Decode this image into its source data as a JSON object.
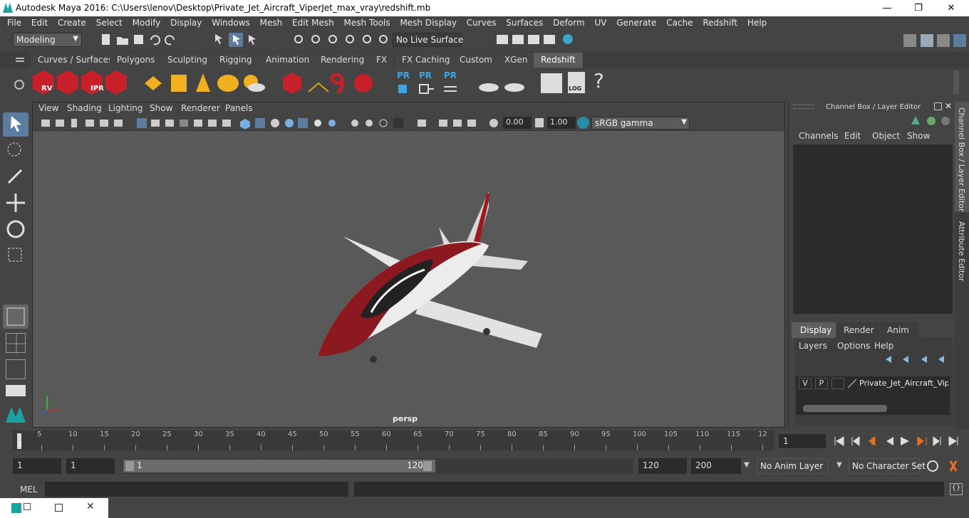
{
  "titlebar": {
    "title": "Autodesk Maya 2016: C:\\Users\\lenov\\Desktop\\Private_Jet_Aircraft_ViperJet_max_vray\\redshift.mb",
    "minimize": "—",
    "maximize": "❐",
    "close": "✕"
  },
  "menubar": [
    "File",
    "Edit",
    "Create",
    "Select",
    "Modify",
    "Display",
    "Windows",
    "Mesh",
    "Edit Mesh",
    "Mesh Tools",
    "Mesh Display",
    "Curves",
    "Surfaces",
    "Deform",
    "UV",
    "Generate",
    "Cache",
    "Redshift",
    "Help"
  ],
  "status": {
    "mode": "Modeling",
    "live_surface": "No Live Surface"
  },
  "shelf_tabs": [
    "Curves / Surfaces",
    "Polygons",
    "Sculpting",
    "Rigging",
    "Animation",
    "Rendering",
    "FX",
    "FX Caching",
    "Custom",
    "XGen",
    "Redshift"
  ],
  "shelf_active": "Redshift",
  "shelf_icons": {
    "rv": "RV",
    "ipr": "IPR",
    "pr1": "PR",
    "pr2": "PR",
    "pr3": "PR",
    "log": "LOG",
    "help": "?"
  },
  "viewport": {
    "menu": [
      "View",
      "Shading",
      "Lighting",
      "Show",
      "Renderer",
      "Panels"
    ],
    "exposure": "0.00",
    "gamma": "1.00",
    "color_space": "sRGB gamma",
    "camera": "persp"
  },
  "channel_box": {
    "title": "Channel Box / Layer Editor",
    "menu": [
      "Channels",
      "Edit",
      "Object",
      "Show"
    ],
    "layer_tabs": [
      "Display",
      "Render",
      "Anim"
    ],
    "layer_menu": [
      "Layers",
      "Options",
      "Help"
    ],
    "layer": {
      "v": "V",
      "p": "P",
      "name": "Private_Jet_Aircraft_Viper"
    }
  },
  "side_tabs": [
    "Channel Box / Layer Editor",
    "Attribute Editor"
  ],
  "timeline": {
    "ticks": [
      "5",
      "10",
      "15",
      "20",
      "25",
      "30",
      "35",
      "40",
      "45",
      "50",
      "55",
      "60",
      "65",
      "70",
      "75",
      "80",
      "85",
      "90",
      "95",
      "100",
      "105",
      "110",
      "115",
      "12"
    ],
    "current_marker": "1",
    "current_frame": "1"
  },
  "range": {
    "start": "1",
    "playback_start": "1",
    "slider_start": "1",
    "slider_end": "120",
    "playback_end": "120",
    "end": "200",
    "anim_layer": "No Anim Layer",
    "char_set": "No Character Set"
  },
  "cmdline": {
    "label": "MEL"
  },
  "colors": {
    "accent": "#5d5d5d",
    "brand": "#1aa3a0",
    "redshift_red": "#c8202a"
  }
}
